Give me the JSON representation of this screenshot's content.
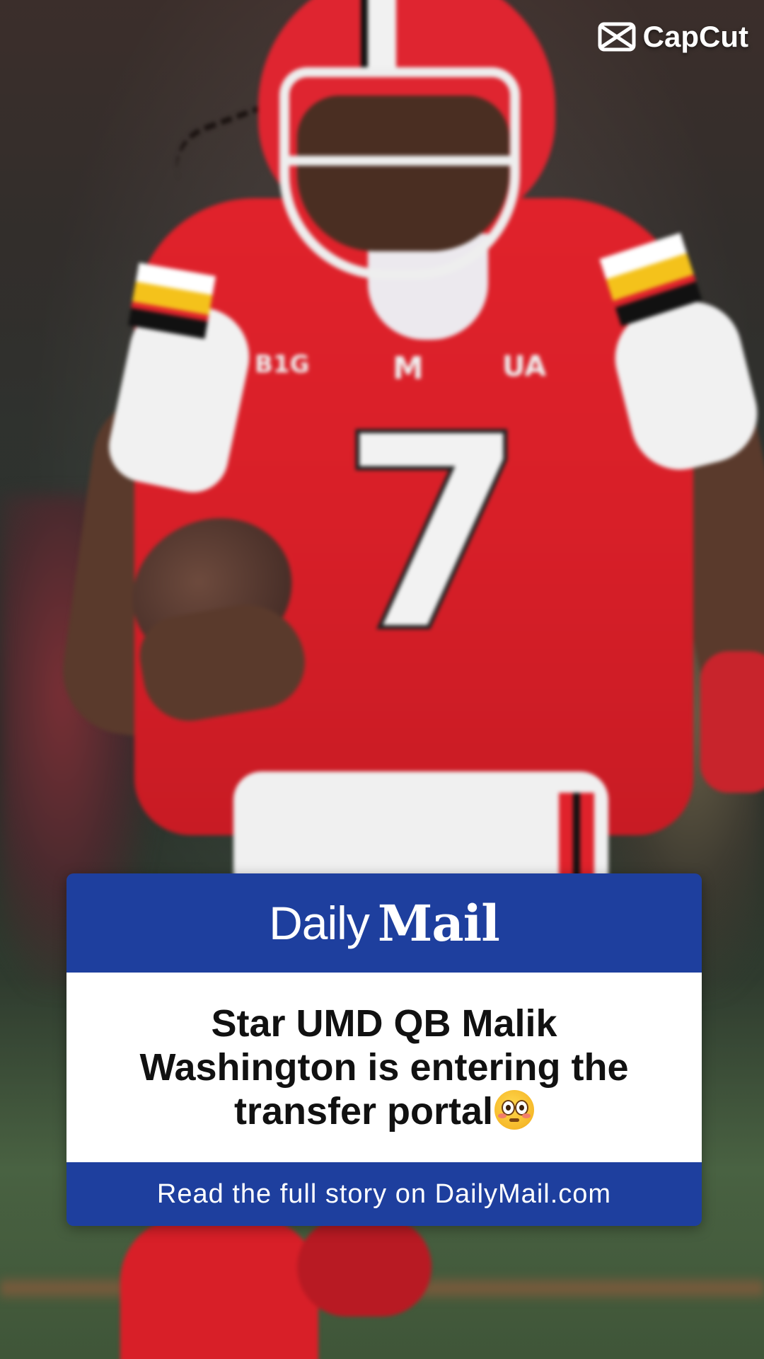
{
  "watermark": {
    "label": "CapCut",
    "icon": "capcut-logo-icon"
  },
  "photo": {
    "jersey_number": "7",
    "chest_left_logo": "B1G",
    "chest_center_logo": "M",
    "chest_right_logo": "UA"
  },
  "card": {
    "brand_daily": "Daily",
    "brand_mail": "Mail",
    "headline": "Star UMD QB Malik Washington is entering the transfer portal",
    "headline_emoji": "flushed-face-emoji",
    "footer": "Read the full story on DailyMail.com",
    "header_color": "#1e3f9e",
    "body_color": "#ffffff"
  }
}
